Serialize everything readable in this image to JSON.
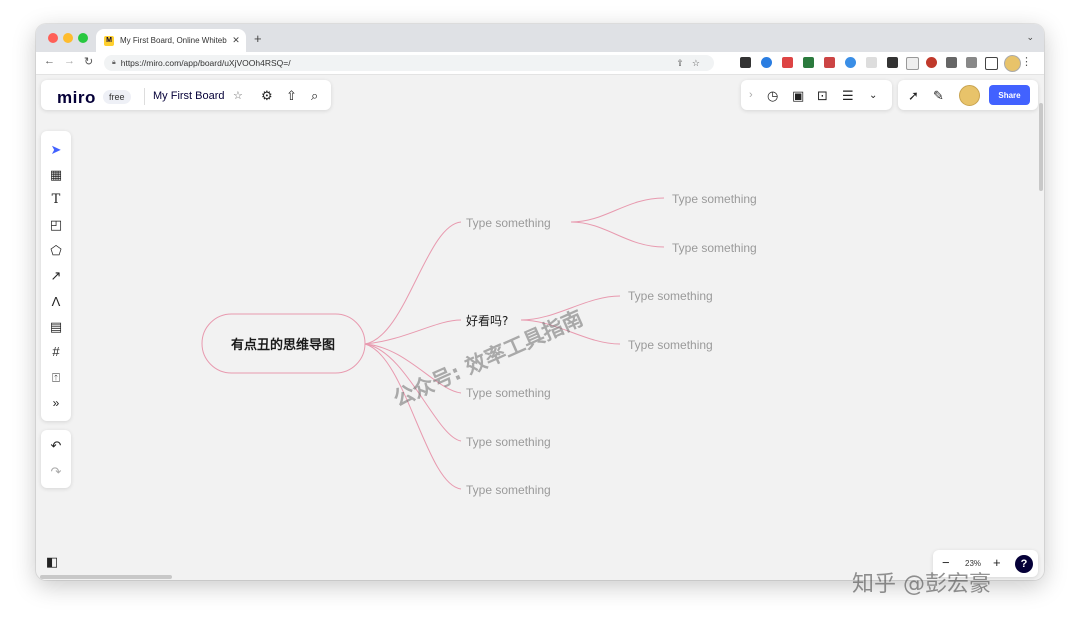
{
  "browser": {
    "tab_title": "My First Board, Online Whiteb",
    "tab_close": "✕",
    "new_tab": "+",
    "tab_menu": "⌄",
    "url": "https://miro.com/app/board/uXjVOOh4RSQ=/"
  },
  "miro": {
    "logo": "miro",
    "plan_badge": "free",
    "board_title": "My First Board",
    "share_label": "Share",
    "zoom_level": "23%",
    "zoom_out": "−",
    "zoom_in": "+",
    "help": "?"
  },
  "left_toolbar": {
    "tools": [
      "select-cursor-icon",
      "templates-icon",
      "text-icon",
      "sticky-note-icon",
      "shapes-icon",
      "connection-line-icon",
      "pen-icon",
      "comment-icon",
      "frame-icon",
      "upload-icon",
      "more-tools-icon"
    ],
    "more": "»",
    "undo": "↶",
    "redo": "↷"
  },
  "mindmap": {
    "root": "有点丑的思维导图",
    "branch_color": "#e89aaf",
    "node_text_color": "#9a9a9a",
    "root_border_color": "#e89aaf",
    "level1": [
      {
        "text": "Type something",
        "children": [
          "Type something",
          "Type something"
        ]
      },
      {
        "text": "好看吗?",
        "children": [
          "Type something",
          "Type something"
        ]
      },
      {
        "text": "Type something",
        "children": []
      },
      {
        "text": "Type something",
        "children": []
      },
      {
        "text": "Type something",
        "children": []
      }
    ]
  },
  "overlay": {
    "watermark_center": "公众号: 效率工具指南",
    "watermark_corner": "知乎 @彭宏豪"
  },
  "colors": {
    "accent": "#4262ff",
    "canvas_bg": "#f2f2f2"
  }
}
